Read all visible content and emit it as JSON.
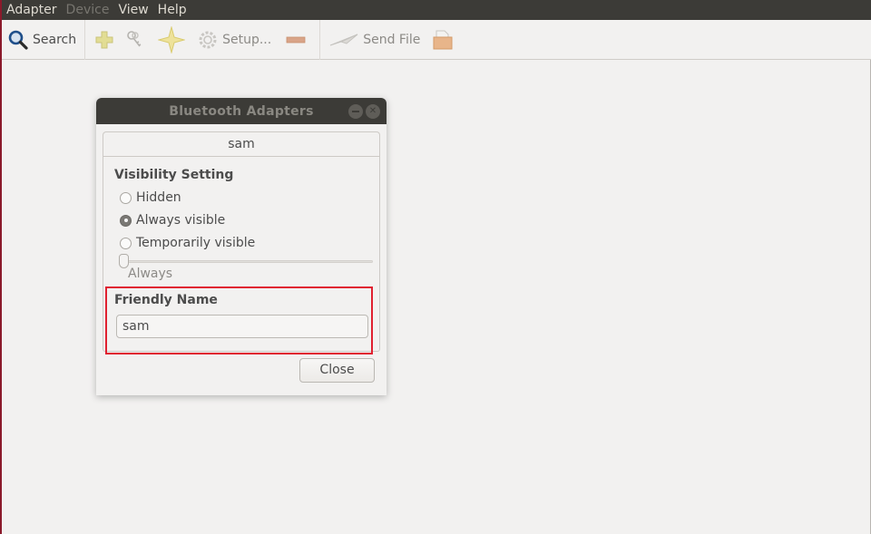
{
  "menubar": {
    "items": [
      {
        "label": "Adapter",
        "enabled": true
      },
      {
        "label": "Device",
        "enabled": false
      },
      {
        "label": "View",
        "enabled": true
      },
      {
        "label": "Help",
        "enabled": true
      }
    ]
  },
  "toolbar": {
    "search_label": "Search",
    "setup_label": "Setup...",
    "send_file_label": "Send File",
    "icons": [
      "search-icon",
      "add-icon",
      "keys-icon",
      "star-icon",
      "gear-icon",
      "remove-icon",
      "paper-plane-icon",
      "folder-icon"
    ]
  },
  "dialog": {
    "title": "Bluetooth Adapters",
    "tab_label": "sam",
    "visibility": {
      "heading": "Visibility Setting",
      "options": [
        {
          "label": "Hidden",
          "checked": false
        },
        {
          "label": "Always visible",
          "checked": true
        },
        {
          "label": "Temporarily visible",
          "checked": false
        }
      ],
      "slider_value_label": "Always",
      "slider_fraction": 0.0
    },
    "friendly_name": {
      "heading": "Friendly Name",
      "value": "sam"
    },
    "close_label": "Close"
  },
  "colors": {
    "highlight": "#e02030",
    "titlebar": "#3c3b37",
    "background": "#f2f1f0"
  }
}
